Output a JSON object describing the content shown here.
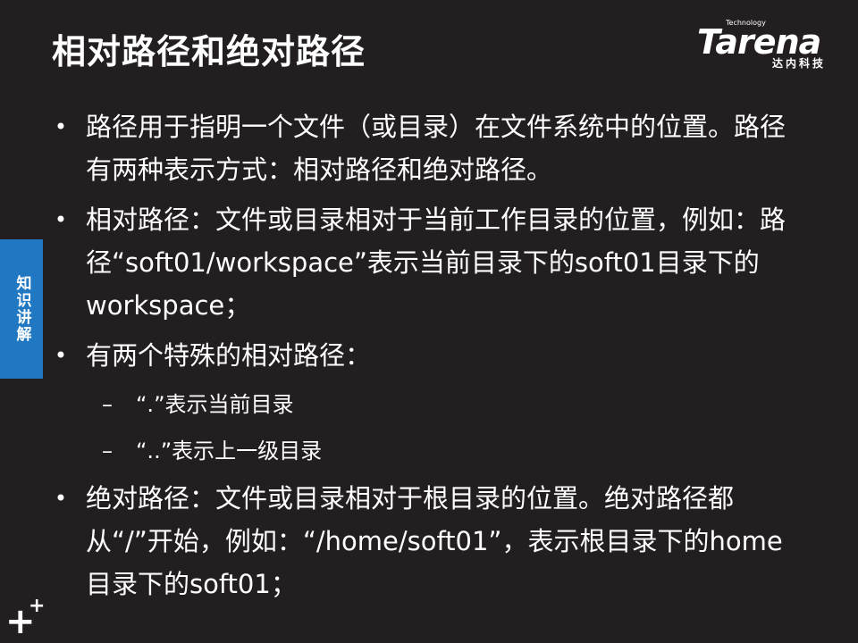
{
  "slide": {
    "title": "相对路径和绝对路径",
    "side_tab_label": "知识讲解",
    "logo": {
      "brand": "Tarena",
      "tagline": "Technology",
      "cn": "达内科技"
    },
    "items": [
      {
        "kind": "bullet",
        "text": "路径用于指明一个文件（或目录）在文件系统中的位置。路径有两种表示方式：相对路径和绝对路径。"
      },
      {
        "kind": "bullet",
        "text": "相对路径：文件或目录相对于当前工作目录的位置，例如：路径“soft01/workspace”表示当前目录下的soft01目录下的workspace；"
      },
      {
        "kind": "bullet",
        "text": "有两个特殊的相对路径："
      },
      {
        "kind": "sub",
        "text": "“.”表示当前目录"
      },
      {
        "kind": "sub",
        "text": "“..”表示上一级目录"
      },
      {
        "kind": "bullet",
        "text": "绝对路径：文件或目录相对于根目录的位置。绝对路径都从“/”开始，例如：“/home/soft01”，表示根目录下的home目录下的soft01；"
      }
    ],
    "bullet_symbol": "•",
    "sub_symbol": "–",
    "decor_icon": "plus-mark-icon"
  },
  "colors": {
    "background": "#231f20",
    "accent": "#1f78c1",
    "text": "#ffffff"
  }
}
